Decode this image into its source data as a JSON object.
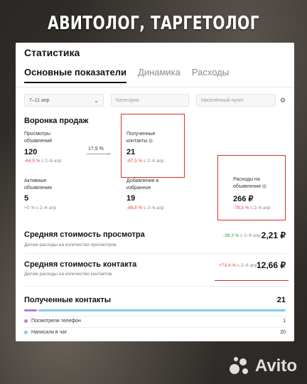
{
  "banner": "АВИТОЛОГ, ТАРГЕТОЛОГ",
  "card": {
    "title": "Статистика",
    "tabs": [
      {
        "label": "Основные показатели",
        "active": true
      },
      {
        "label": "Динамика",
        "active": false
      },
      {
        "label": "Расходы",
        "active": false
      }
    ]
  },
  "filters": {
    "date": "7–11 апр",
    "category_placeholder": "Категория",
    "city_placeholder": "Населённый пункт"
  },
  "funnel": {
    "title": "Воронка продаж",
    "conversion": "17,5 %",
    "metrics": [
      {
        "id": "views",
        "label": "Просмотры объявлений",
        "value": "120",
        "delta": "-64,9 %",
        "period": "с 2–6 апр"
      },
      {
        "id": "contacts",
        "label": "Полученные контакты",
        "value": "21",
        "delta": "-87,5 %",
        "period": "с 2–6 апр"
      },
      {
        "id": "active",
        "label": "Активные объявления",
        "value": "5",
        "delta": "+0 %",
        "period": "с 2–6 апр"
      },
      {
        "id": "favorites",
        "label": "Добавления в избранное",
        "value": "19",
        "delta": "-88,8 %",
        "period": "с 2–6 апр"
      },
      {
        "id": "spend",
        "label": "Расходы на объявления",
        "value": "266 ₽",
        "delta": "-78,3 %",
        "period": "с 2–6 апр"
      }
    ]
  },
  "avg_view": {
    "title": "Средняя стоимость просмотра",
    "sub": "Делим расходы на количество просмотров.",
    "delta": "-38,3 %",
    "period": "с 2–6 апр",
    "value": "2,21 ₽"
  },
  "avg_contact": {
    "title": "Средняя стоимость контакта",
    "sub": "Делим расходы на количество контактов.",
    "delta": "+73,4 %",
    "period": "с 2–6 апр",
    "value": "12,66 ₽"
  },
  "contacts_breakdown": {
    "title": "Полученные контакты",
    "total": "21",
    "items": [
      {
        "label": "Посмотрели телефон",
        "value": "1",
        "share": 0.048,
        "color": "#b67ee0"
      },
      {
        "label": "Написали в чат",
        "value": "20",
        "share": 0.952,
        "color": "#7fd0e6"
      }
    ]
  },
  "watermark": "Avito",
  "colors": {
    "negative": "#e4453a",
    "positive": "#2a9d3f",
    "highlight": "#d93025"
  }
}
